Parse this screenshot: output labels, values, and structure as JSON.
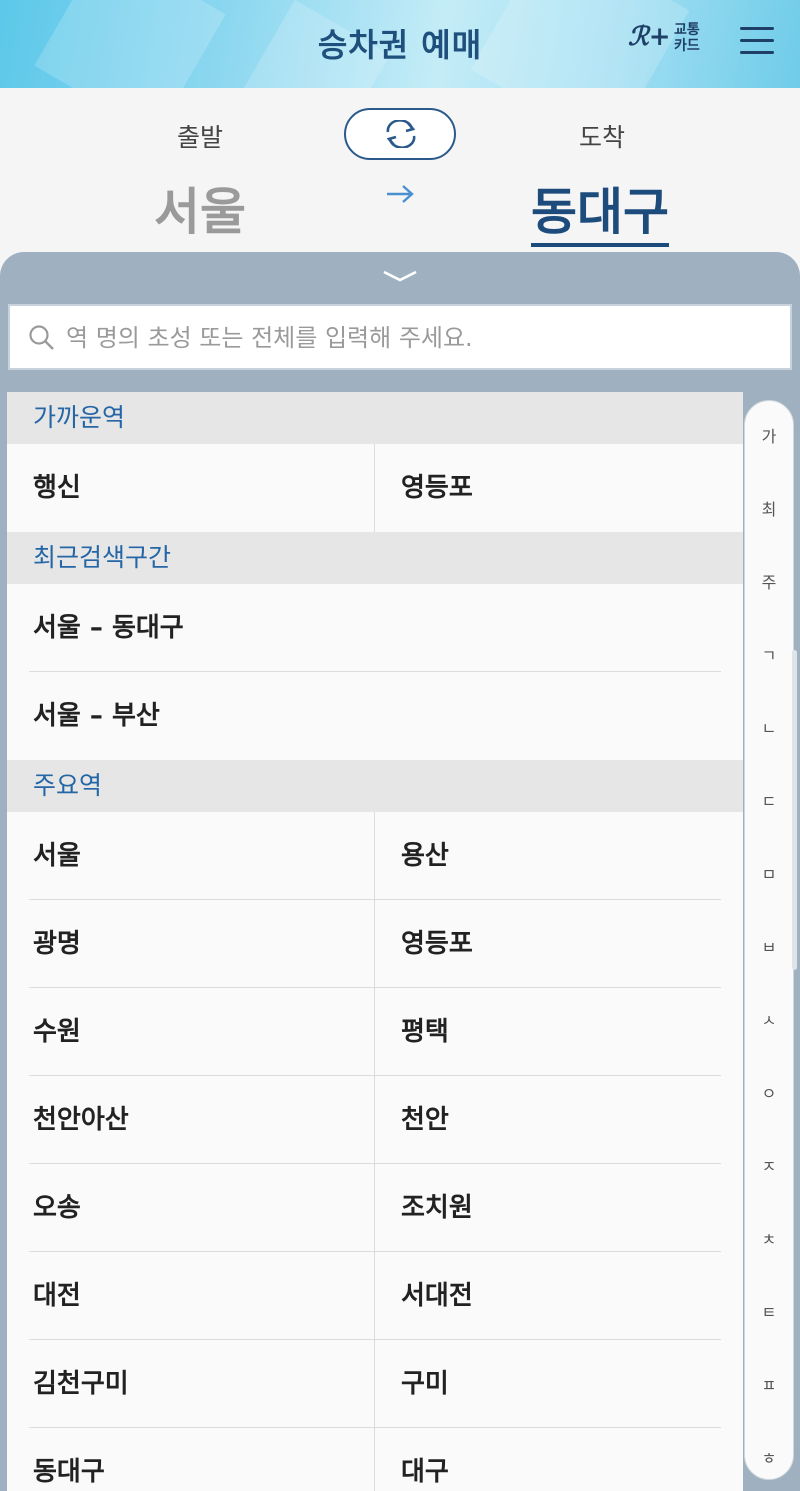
{
  "header": {
    "title": "승차권 예매",
    "logo_mark": "ℛ+",
    "logo_line1": "교통",
    "logo_line2": "카드"
  },
  "route": {
    "departure_label": "출발",
    "arrival_label": "도착",
    "departure_city": "서울",
    "arrival_city": "동대구"
  },
  "search": {
    "placeholder": "역 명의 초성 또는 전체를 입력해 주세요."
  },
  "sections": {
    "nearby": {
      "title": "가까운역",
      "stations": [
        "행신",
        "영등포"
      ]
    },
    "recent": {
      "title": "최근검색구간",
      "routes": [
        "서울 – 동대구",
        "서울 – 부산"
      ]
    },
    "major": {
      "title": "주요역",
      "stations": [
        "서울",
        "용산",
        "광명",
        "영등포",
        "수원",
        "평택",
        "천안아산",
        "천안",
        "오송",
        "조치원",
        "대전",
        "서대전",
        "김천구미",
        "구미",
        "동대구",
        "대구"
      ]
    }
  },
  "index": [
    "가",
    "최",
    "주",
    "ㄱ",
    "ㄴ",
    "ㄷ",
    "ㅁ",
    "ㅂ",
    "ㅅ",
    "ㅇ",
    "ㅈ",
    "ㅊ",
    "ㅌ",
    "ㅍ",
    "ㅎ"
  ],
  "colors": {
    "brand_blue": "#1d4c7c",
    "section_blue": "#2566a6",
    "panel_gray": "#9fb0c0"
  }
}
